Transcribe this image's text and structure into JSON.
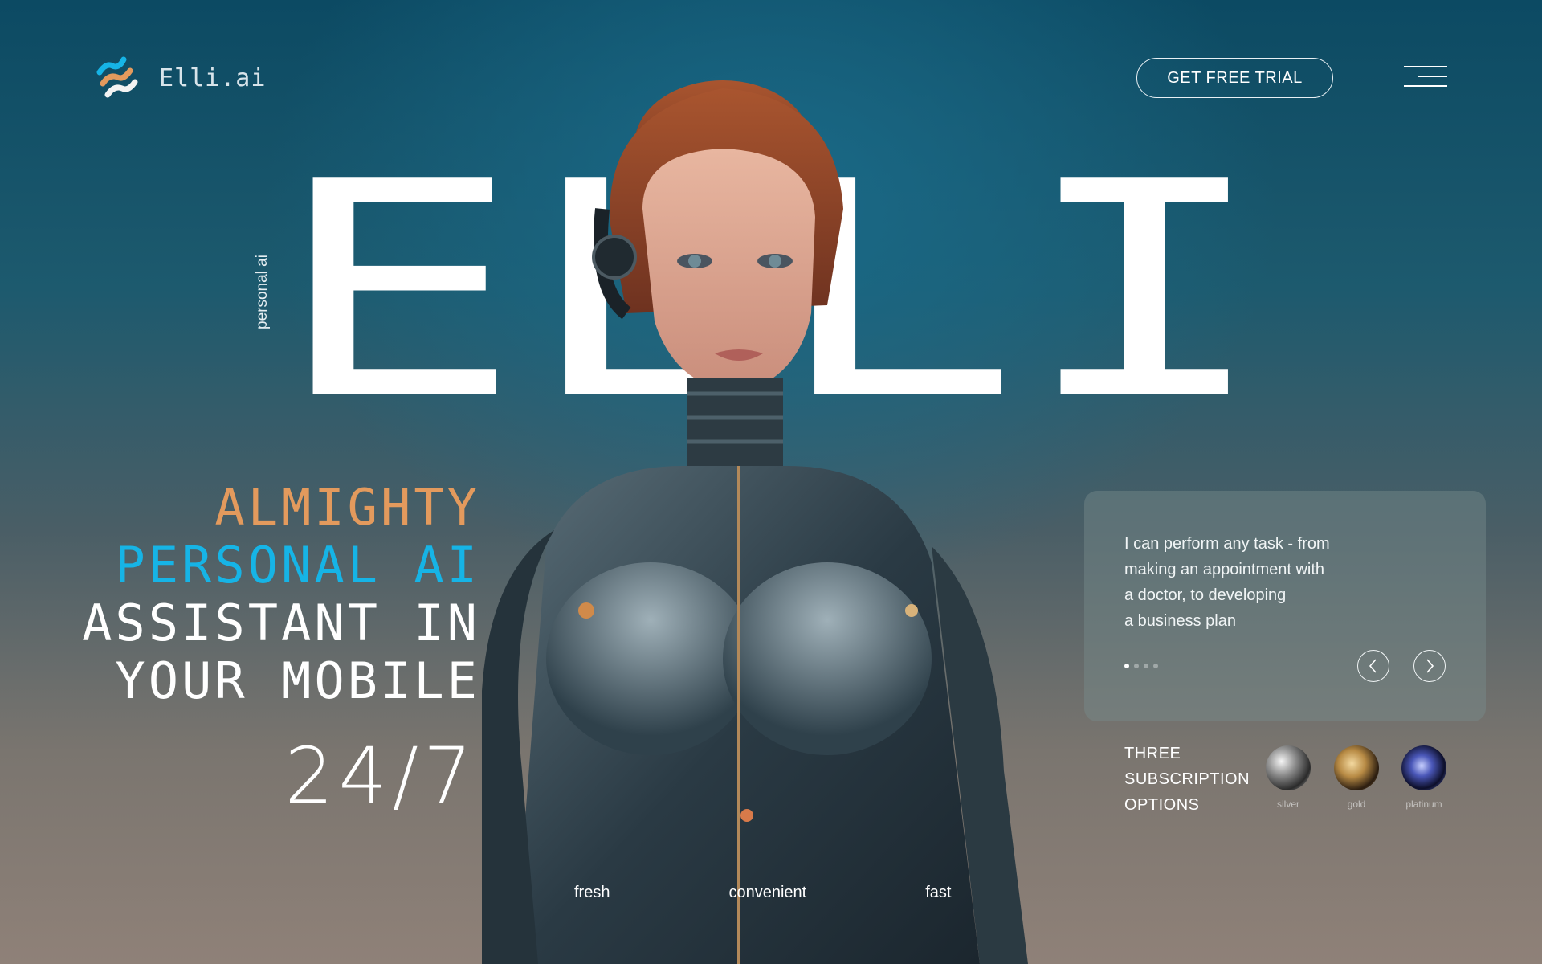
{
  "brand": {
    "name": "Elli.ai"
  },
  "header": {
    "cta_label": "GET FREE TRIAL",
    "menu_icon": "hamburger-menu-icon"
  },
  "hero": {
    "title": "ELLI",
    "vertical_tag": "personal ai",
    "headline": {
      "line1": "ALMIGHTY",
      "line2": "PERSONAL AI",
      "line3": "ASSISTANT IN",
      "line4": "YOUR MOBILE"
    },
    "availability": "24/7"
  },
  "card": {
    "line1": "I can perform any task - from",
    "line2": "making an appointment with",
    "line3": "a doctor,  to developing",
    "line4": "a business plan",
    "slide_count": 4,
    "active_slide": 1,
    "prev_icon": "chevron-left-icon",
    "next_icon": "chevron-right-icon"
  },
  "subscriptions": {
    "title_line1": "THREE",
    "title_line2": "SUBSCRIPTION",
    "title_line3": "OPTIONS",
    "options": [
      {
        "label": "silver"
      },
      {
        "label": "gold"
      },
      {
        "label": "platinum"
      }
    ]
  },
  "features": {
    "first": "fresh",
    "second": "convenient",
    "third": "fast"
  },
  "colors": {
    "accent_orange": "#e39a5d",
    "accent_blue": "#16b4e6",
    "background_top": "#0c4a63",
    "background_bottom": "#8f8178"
  }
}
